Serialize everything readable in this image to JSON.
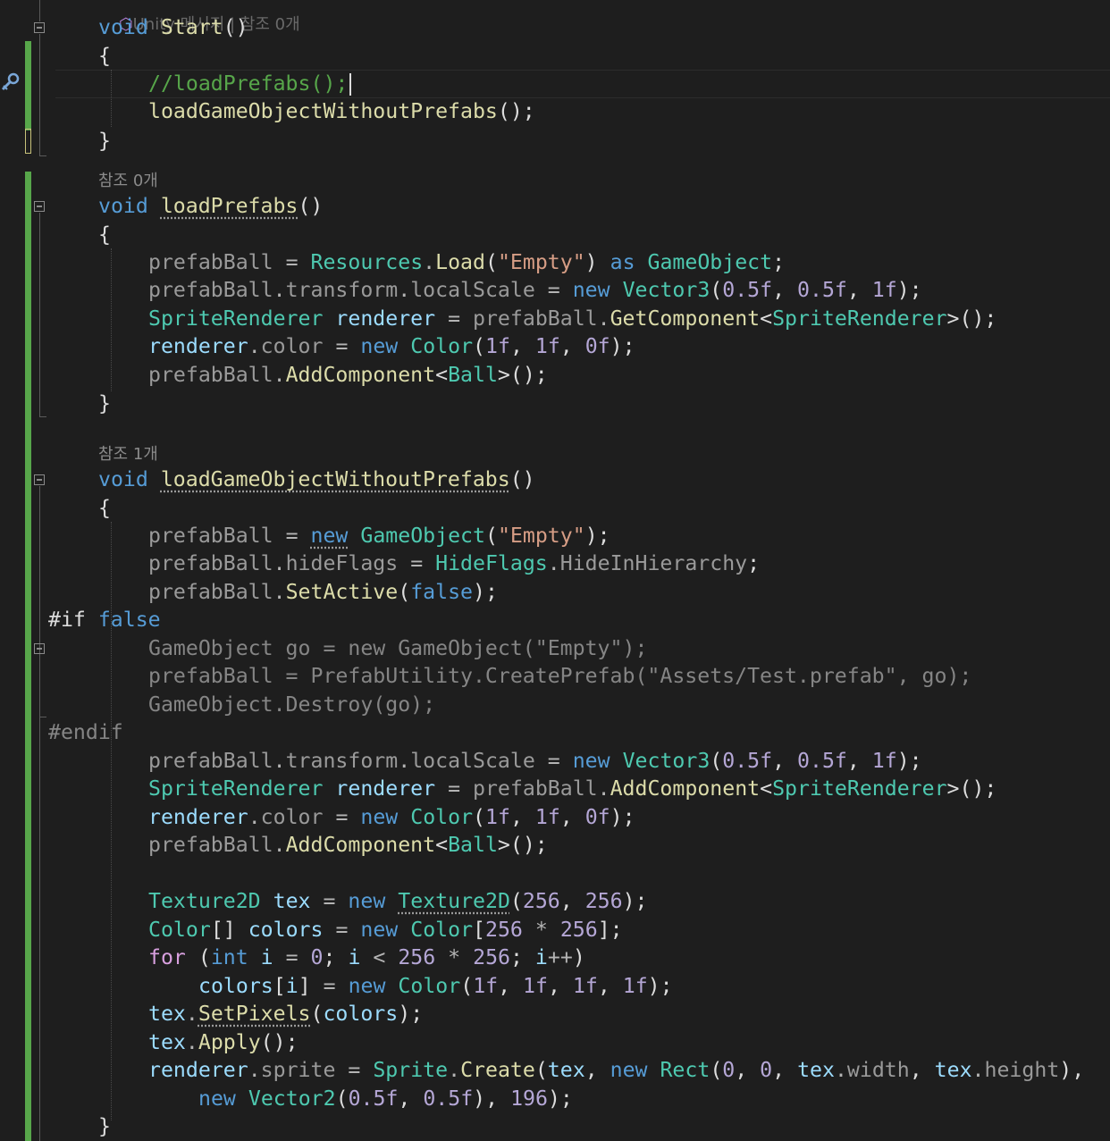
{
  "editor": {
    "language": "C#",
    "codelens": {
      "top": "Unity 메시지 | 참조 0개",
      "load_prefabs": "참조 0개",
      "load_go_without_prefabs": "참조 1개"
    },
    "lines": [
      {
        "tokens": [
          [
            "k",
            "void"
          ],
          [
            "x",
            " "
          ],
          [
            "m",
            "Start"
          ],
          [
            "x",
            "()"
          ]
        ]
      },
      {
        "tokens": [
          [
            "x",
            "{"
          ]
        ]
      },
      {
        "tokens": [
          [
            "c",
            "//loadPrefabs();"
          ]
        ]
      },
      {
        "tokens": [
          [
            "m",
            "loadGameObjectWithoutPrefabs"
          ],
          [
            "x",
            "();"
          ]
        ]
      },
      {
        "tokens": [
          [
            "x",
            "}"
          ]
        ]
      },
      {
        "tokens": [
          [
            "k",
            "void"
          ],
          [
            "x",
            " "
          ],
          [
            "m",
            "loadPrefabs",
            "sq"
          ],
          [
            "x",
            "()"
          ]
        ]
      },
      {
        "tokens": [
          [
            "x",
            "{"
          ]
        ]
      },
      {
        "tokens": [
          [
            "p",
            "prefabBall"
          ],
          [
            "x",
            " "
          ],
          [
            "o",
            "="
          ],
          [
            "x",
            " "
          ],
          [
            "t",
            "Resources"
          ],
          [
            "o",
            "."
          ],
          [
            "m",
            "Load"
          ],
          [
            "x",
            "("
          ],
          [
            "s",
            "\"Empty\""
          ],
          [
            "x",
            ")"
          ],
          [
            "x",
            " "
          ],
          [
            "k",
            "as"
          ],
          [
            "x",
            " "
          ],
          [
            "t",
            "GameObject"
          ],
          [
            "x",
            ";"
          ]
        ]
      },
      {
        "tokens": [
          [
            "p",
            "prefabBall"
          ],
          [
            "o",
            "."
          ],
          [
            "p",
            "transform"
          ],
          [
            "o",
            "."
          ],
          [
            "p",
            "localScale"
          ],
          [
            "x",
            " "
          ],
          [
            "o",
            "="
          ],
          [
            "x",
            " "
          ],
          [
            "k",
            "new"
          ],
          [
            "x",
            " "
          ],
          [
            "t",
            "Vector3"
          ],
          [
            "x",
            "("
          ],
          [
            "n",
            "0.5f"
          ],
          [
            "x",
            ", "
          ],
          [
            "n",
            "0.5f"
          ],
          [
            "x",
            ", "
          ],
          [
            "n",
            "1f"
          ],
          [
            "x",
            ");"
          ]
        ]
      },
      {
        "tokens": [
          [
            "t",
            "SpriteRenderer"
          ],
          [
            "x",
            " "
          ],
          [
            "v",
            "renderer"
          ],
          [
            "x",
            " "
          ],
          [
            "o",
            "="
          ],
          [
            "x",
            " "
          ],
          [
            "p",
            "prefabBall"
          ],
          [
            "o",
            "."
          ],
          [
            "m",
            "GetComponent"
          ],
          [
            "x",
            "<"
          ],
          [
            "t",
            "SpriteRenderer"
          ],
          [
            "x",
            ">();"
          ]
        ]
      },
      {
        "tokens": [
          [
            "v",
            "renderer"
          ],
          [
            "o",
            "."
          ],
          [
            "p",
            "color"
          ],
          [
            "x",
            " "
          ],
          [
            "o",
            "="
          ],
          [
            "x",
            " "
          ],
          [
            "k",
            "new"
          ],
          [
            "x",
            " "
          ],
          [
            "t",
            "Color"
          ],
          [
            "x",
            "("
          ],
          [
            "n",
            "1f"
          ],
          [
            "x",
            ", "
          ],
          [
            "n",
            "1f"
          ],
          [
            "x",
            ", "
          ],
          [
            "n",
            "0f"
          ],
          [
            "x",
            ");"
          ]
        ]
      },
      {
        "tokens": [
          [
            "p",
            "prefabBall"
          ],
          [
            "o",
            "."
          ],
          [
            "m",
            "AddComponent"
          ],
          [
            "x",
            "<"
          ],
          [
            "t",
            "Ball"
          ],
          [
            "x",
            ">();"
          ]
        ]
      },
      {
        "tokens": [
          [
            "x",
            "}"
          ]
        ]
      },
      {
        "tokens": [
          [
            "k",
            "void"
          ],
          [
            "x",
            " "
          ],
          [
            "m",
            "loadGameObjectWithoutPrefabs",
            "sq"
          ],
          [
            "x",
            "()"
          ]
        ]
      },
      {
        "tokens": [
          [
            "x",
            "{"
          ]
        ]
      },
      {
        "tokens": [
          [
            "p",
            "prefabBall"
          ],
          [
            "x",
            " "
          ],
          [
            "o",
            "="
          ],
          [
            "x",
            " "
          ],
          [
            "k",
            "new",
            "sq"
          ],
          [
            "x",
            " "
          ],
          [
            "t",
            "GameObject"
          ],
          [
            "x",
            "("
          ],
          [
            "s",
            "\"Empty\""
          ],
          [
            "x",
            ");"
          ]
        ]
      },
      {
        "tokens": [
          [
            "p",
            "prefabBall"
          ],
          [
            "o",
            "."
          ],
          [
            "p",
            "hideFlags"
          ],
          [
            "x",
            " "
          ],
          [
            "o",
            "="
          ],
          [
            "x",
            " "
          ],
          [
            "t",
            "HideFlags"
          ],
          [
            "o",
            "."
          ],
          [
            "p",
            "HideInHierarchy"
          ],
          [
            "x",
            ";"
          ]
        ]
      },
      {
        "tokens": [
          [
            "p",
            "prefabBall"
          ],
          [
            "o",
            "."
          ],
          [
            "m",
            "SetActive"
          ],
          [
            "x",
            "("
          ],
          [
            "k",
            "false"
          ],
          [
            "x",
            ");"
          ]
        ]
      },
      {
        "tokens": [
          [
            "x",
            "#if "
          ],
          [
            "k",
            "false"
          ]
        ]
      },
      {
        "tokens": [
          [
            "d",
            "GameObject go = new GameObject(\"Empty\");"
          ]
        ]
      },
      {
        "tokens": [
          [
            "d",
            "prefabBall = PrefabUtility.CreatePrefab(\"Assets/Test.prefab\", go);"
          ]
        ]
      },
      {
        "tokens": [
          [
            "d",
            "GameObject.Destroy(go);"
          ]
        ]
      },
      {
        "tokens": [
          [
            "d",
            "#endif"
          ]
        ]
      },
      {
        "tokens": [
          [
            "p",
            "prefabBall"
          ],
          [
            "o",
            "."
          ],
          [
            "p",
            "transform"
          ],
          [
            "o",
            "."
          ],
          [
            "p",
            "localScale"
          ],
          [
            "x",
            " "
          ],
          [
            "o",
            "="
          ],
          [
            "x",
            " "
          ],
          [
            "k",
            "new"
          ],
          [
            "x",
            " "
          ],
          [
            "t",
            "Vector3"
          ],
          [
            "x",
            "("
          ],
          [
            "n",
            "0.5f"
          ],
          [
            "x",
            ", "
          ],
          [
            "n",
            "0.5f"
          ],
          [
            "x",
            ", "
          ],
          [
            "n",
            "1f"
          ],
          [
            "x",
            ");"
          ]
        ]
      },
      {
        "tokens": [
          [
            "t",
            "SpriteRenderer"
          ],
          [
            "x",
            " "
          ],
          [
            "v",
            "renderer"
          ],
          [
            "x",
            " "
          ],
          [
            "o",
            "="
          ],
          [
            "x",
            " "
          ],
          [
            "p",
            "prefabBall"
          ],
          [
            "o",
            "."
          ],
          [
            "m",
            "AddComponent"
          ],
          [
            "x",
            "<"
          ],
          [
            "t",
            "SpriteRenderer"
          ],
          [
            "x",
            ">();"
          ]
        ]
      },
      {
        "tokens": [
          [
            "v",
            "renderer"
          ],
          [
            "o",
            "."
          ],
          [
            "p",
            "color"
          ],
          [
            "x",
            " "
          ],
          [
            "o",
            "="
          ],
          [
            "x",
            " "
          ],
          [
            "k",
            "new"
          ],
          [
            "x",
            " "
          ],
          [
            "t",
            "Color"
          ],
          [
            "x",
            "("
          ],
          [
            "n",
            "1f"
          ],
          [
            "x",
            ", "
          ],
          [
            "n",
            "1f"
          ],
          [
            "x",
            ", "
          ],
          [
            "n",
            "0f"
          ],
          [
            "x",
            ");"
          ]
        ]
      },
      {
        "tokens": [
          [
            "p",
            "prefabBall"
          ],
          [
            "o",
            "."
          ],
          [
            "m",
            "AddComponent"
          ],
          [
            "x",
            "<"
          ],
          [
            "t",
            "Ball"
          ],
          [
            "x",
            ">();"
          ]
        ]
      },
      {
        "tokens": []
      },
      {
        "tokens": [
          [
            "t",
            "Texture2D"
          ],
          [
            "x",
            " "
          ],
          [
            "v",
            "tex"
          ],
          [
            "x",
            " "
          ],
          [
            "o",
            "="
          ],
          [
            "x",
            " "
          ],
          [
            "k",
            "new"
          ],
          [
            "x",
            " "
          ],
          [
            "t",
            "Texture2D",
            "sq"
          ],
          [
            "x",
            "("
          ],
          [
            "n",
            "256"
          ],
          [
            "x",
            ", "
          ],
          [
            "n",
            "256"
          ],
          [
            "x",
            ");"
          ]
        ]
      },
      {
        "tokens": [
          [
            "t",
            "Color"
          ],
          [
            "x",
            "[] "
          ],
          [
            "v",
            "colors"
          ],
          [
            "x",
            " "
          ],
          [
            "o",
            "="
          ],
          [
            "x",
            " "
          ],
          [
            "k",
            "new"
          ],
          [
            "x",
            " "
          ],
          [
            "t",
            "Color"
          ],
          [
            "x",
            "["
          ],
          [
            "n",
            "256"
          ],
          [
            "x",
            " "
          ],
          [
            "o",
            "*"
          ],
          [
            "x",
            " "
          ],
          [
            "n",
            "256"
          ],
          [
            "x",
            "];"
          ]
        ]
      },
      {
        "tokens": [
          [
            "kc",
            "for"
          ],
          [
            "x",
            " ("
          ],
          [
            "k",
            "int"
          ],
          [
            "x",
            " "
          ],
          [
            "v",
            "i"
          ],
          [
            "x",
            " "
          ],
          [
            "o",
            "="
          ],
          [
            "x",
            " "
          ],
          [
            "n",
            "0"
          ],
          [
            "x",
            "; "
          ],
          [
            "v",
            "i"
          ],
          [
            "x",
            " "
          ],
          [
            "o",
            "<"
          ],
          [
            "x",
            " "
          ],
          [
            "n",
            "256"
          ],
          [
            "x",
            " "
          ],
          [
            "o",
            "*"
          ],
          [
            "x",
            " "
          ],
          [
            "n",
            "256"
          ],
          [
            "x",
            "; "
          ],
          [
            "v",
            "i"
          ],
          [
            "o",
            "++"
          ],
          [
            "x",
            ")"
          ]
        ]
      },
      {
        "tokens": [
          [
            "v",
            "colors"
          ],
          [
            "x",
            "["
          ],
          [
            "v",
            "i"
          ],
          [
            "x",
            "] "
          ],
          [
            "o",
            "="
          ],
          [
            "x",
            " "
          ],
          [
            "k",
            "new"
          ],
          [
            "x",
            " "
          ],
          [
            "t",
            "Color"
          ],
          [
            "x",
            "("
          ],
          [
            "n",
            "1f"
          ],
          [
            "x",
            ", "
          ],
          [
            "n",
            "1f"
          ],
          [
            "x",
            ", "
          ],
          [
            "n",
            "1f"
          ],
          [
            "x",
            ", "
          ],
          [
            "n",
            "1f"
          ],
          [
            "x",
            ");"
          ]
        ]
      },
      {
        "tokens": [
          [
            "v",
            "tex"
          ],
          [
            "o",
            "."
          ],
          [
            "m",
            "SetPixels",
            "sq"
          ],
          [
            "x",
            "("
          ],
          [
            "v",
            "colors"
          ],
          [
            "x",
            ");"
          ]
        ]
      },
      {
        "tokens": [
          [
            "v",
            "tex"
          ],
          [
            "o",
            "."
          ],
          [
            "m",
            "Apply"
          ],
          [
            "x",
            "();"
          ]
        ]
      },
      {
        "tokens": [
          [
            "v",
            "renderer"
          ],
          [
            "o",
            "."
          ],
          [
            "p",
            "sprite"
          ],
          [
            "x",
            " "
          ],
          [
            "o",
            "="
          ],
          [
            "x",
            " "
          ],
          [
            "t",
            "Sprite"
          ],
          [
            "o",
            "."
          ],
          [
            "m",
            "Create"
          ],
          [
            "x",
            "("
          ],
          [
            "v",
            "tex"
          ],
          [
            "x",
            ", "
          ],
          [
            "k",
            "new"
          ],
          [
            "x",
            " "
          ],
          [
            "t",
            "Rect"
          ],
          [
            "x",
            "("
          ],
          [
            "n",
            "0"
          ],
          [
            "x",
            ", "
          ],
          [
            "n",
            "0"
          ],
          [
            "x",
            ", "
          ],
          [
            "v",
            "tex"
          ],
          [
            "o",
            "."
          ],
          [
            "p",
            "width"
          ],
          [
            "x",
            ", "
          ],
          [
            "v",
            "tex"
          ],
          [
            "o",
            "."
          ],
          [
            "p",
            "height"
          ],
          [
            "x",
            "),"
          ]
        ]
      },
      {
        "tokens": [
          [
            "k",
            "new"
          ],
          [
            "x",
            " "
          ],
          [
            "t",
            "Vector2"
          ],
          [
            "x",
            "("
          ],
          [
            "n",
            "0.5f"
          ],
          [
            "x",
            ", "
          ],
          [
            "n",
            "0.5f"
          ],
          [
            "x",
            "), "
          ],
          [
            "n",
            "196"
          ],
          [
            "x",
            ");"
          ]
        ]
      },
      {
        "tokens": [
          [
            "x",
            "}"
          ]
        ]
      }
    ]
  }
}
